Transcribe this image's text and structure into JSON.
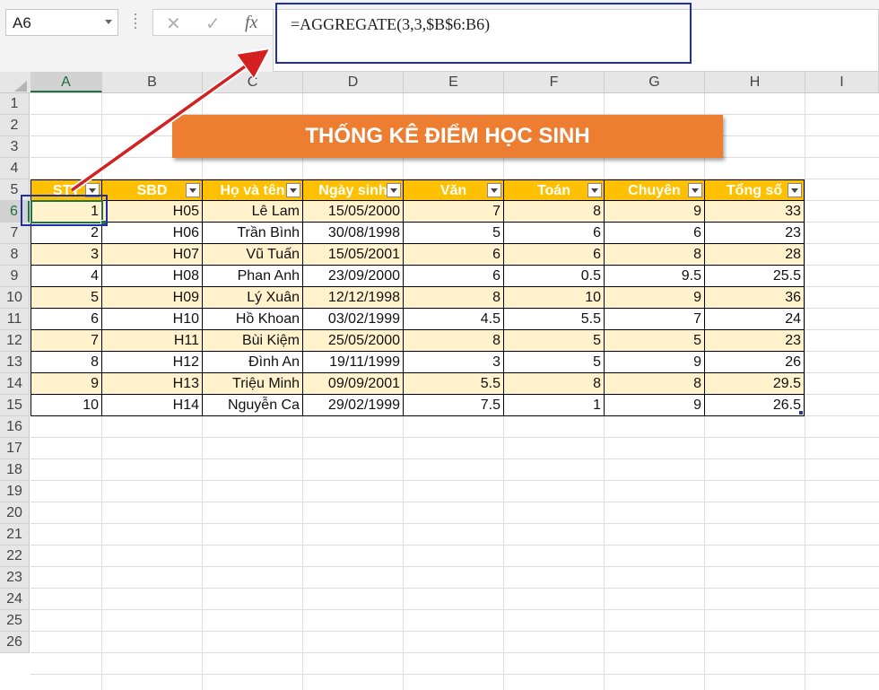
{
  "namebox": {
    "value": "A6"
  },
  "formula_bar": {
    "cancel_icon": "✕",
    "enter_icon": "✓",
    "fx_label": "fx",
    "formula": "=AGGREGATE(3,3,$B$6:B6)"
  },
  "columns": [
    "A",
    "B",
    "C",
    "D",
    "E",
    "F",
    "G",
    "H",
    "I"
  ],
  "rows": [
    "1",
    "2",
    "3",
    "4",
    "5",
    "6",
    "7",
    "8",
    "9",
    "10",
    "11",
    "12",
    "13",
    "14",
    "15",
    "16",
    "17",
    "18",
    "19",
    "20",
    "21",
    "22",
    "23",
    "24",
    "25",
    "26"
  ],
  "banner": {
    "title": "THỐNG KÊ ĐIỂM HỌC SINH"
  },
  "table": {
    "headers": [
      "STT",
      "SBD",
      "Họ và tên",
      "Ngày sinh",
      "Văn",
      "Toán",
      "Chuyên",
      "Tổng số"
    ],
    "rows": [
      [
        "1",
        "H05",
        "Lê Lam",
        "15/05/2000",
        "7",
        "8",
        "9",
        "33"
      ],
      [
        "2",
        "H06",
        "Trần Bình",
        "30/08/1998",
        "5",
        "6",
        "6",
        "23"
      ],
      [
        "3",
        "H07",
        "Vũ Tuấn",
        "15/05/2001",
        "6",
        "6",
        "8",
        "28"
      ],
      [
        "4",
        "H08",
        "Phan Anh",
        "23/09/2000",
        "6",
        "0.5",
        "9.5",
        "25.5"
      ],
      [
        "5",
        "H09",
        "Lý Xuân",
        "12/12/1998",
        "8",
        "10",
        "9",
        "36"
      ],
      [
        "6",
        "H10",
        "Hồ Khoan",
        "03/02/1999",
        "4.5",
        "5.5",
        "7",
        "24"
      ],
      [
        "7",
        "H11",
        "Bùi Kiệm",
        "25/05/2000",
        "8",
        "5",
        "5",
        "23"
      ],
      [
        "8",
        "H12",
        "Đình An",
        "19/11/1999",
        "3",
        "5",
        "9",
        "26"
      ],
      [
        "9",
        "H13",
        "Triệu Minh",
        "09/09/2001",
        "5.5",
        "8",
        "8",
        "29.5"
      ],
      [
        "10",
        "H14",
        "Nguyễn Ca",
        "29/02/1999",
        "7.5",
        "1",
        "9",
        "26.5"
      ]
    ]
  },
  "colors": {
    "header_fill": "#ffc000",
    "band_fill": "#fff2cc",
    "banner_fill": "#ed7d31",
    "highlight_border": "#1f2fa8",
    "arrow": "#d42020"
  }
}
